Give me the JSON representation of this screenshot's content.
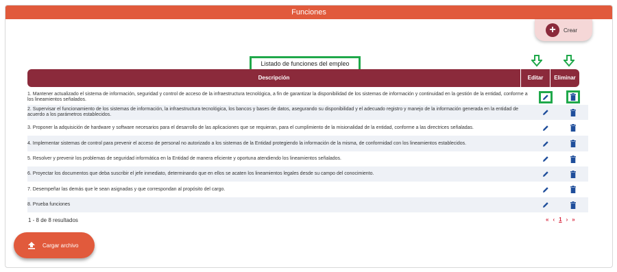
{
  "header": {
    "title": "Funciones"
  },
  "toolbar": {
    "create_label": "Crear",
    "create_icon": "plus-circle-icon"
  },
  "list": {
    "title": "Listado de funciones del empleo"
  },
  "table": {
    "columns": [
      "Descripción",
      "Editar",
      "Eliminar"
    ],
    "rows": [
      {
        "text": "1. Mantener actualizado el sistema de información, seguridad y control de acceso de la infraestructura tecnológica, a fin de garantizar la disponibilidad de los sistemas de información y continuidad en la gestión de la entidad, conforme a los lineamientos señalados."
      },
      {
        "text": "2. Supervisar el funcionamiento de los sistemas de información, la infraestructura tecnológica, los bancos y bases de datos, asegurando su disponibilidad y el adecuado registro y manejo de la información generada en la entidad de acuerdo a los parámetros establecidos."
      },
      {
        "text": "3. Proponer la adquisición de hardware y software necesarios para el desarrollo de las aplicaciones que se requieran, para el cumplimiento de la misionalidad de la entidad, conforme a las directrices señaladas."
      },
      {
        "text": "4. Implementar sistemas de control para prevenir el acceso de personal no autorizado a los sistemas de la Entidad protegiendo la información de la misma, de conformidad con los lineamientos establecidos."
      },
      {
        "text": "5. Resolver y prevenir los problemas de seguridad informática en la Entidad de manera eficiente y oportuna atendiendo los lineamientos señalados."
      },
      {
        "text": "6. Proyectar los documentos que deba suscribir el jefe inmediato, determinando que en ellos se acaten los lineamientos legales desde su campo del conocimiento."
      },
      {
        "text": "7. Desempeñar las demás que le sean asignadas y que correspondan al propósito del cargo."
      },
      {
        "text": "8. Prueba funciones"
      }
    ]
  },
  "footer": {
    "results": "1 - 8 de 8 resultados",
    "pager": {
      "first": "«",
      "prev": "‹",
      "page": "1",
      "next": "›",
      "last": "»"
    },
    "upload_label": "Cargar archivo"
  },
  "colors": {
    "brand": "#e15a3c",
    "header": "#8b2a3b",
    "highlight": "#1fa84a",
    "icon": "#1f4e9b"
  }
}
